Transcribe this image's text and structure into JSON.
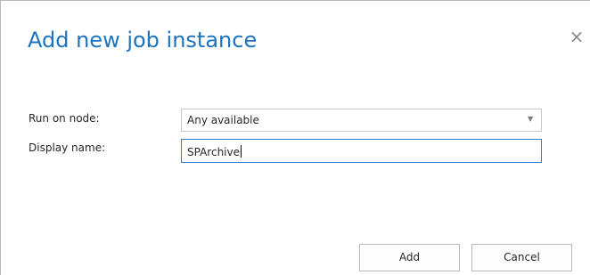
{
  "dialog": {
    "title": "Add new job instance",
    "close_glyph": "×"
  },
  "form": {
    "node_label": "Run on node:",
    "node_value": "Any available",
    "node_arrow": "▼",
    "name_label": "Display name:",
    "name_value": "SPArchive"
  },
  "buttons": {
    "add_label": "Add",
    "cancel_label": "Cancel"
  },
  "colors": {
    "title": "#1e73be",
    "focus_border": "#2a7fd4"
  },
  "icons": {
    "close": "close-icon",
    "dropdown": "chevron-down-icon"
  }
}
